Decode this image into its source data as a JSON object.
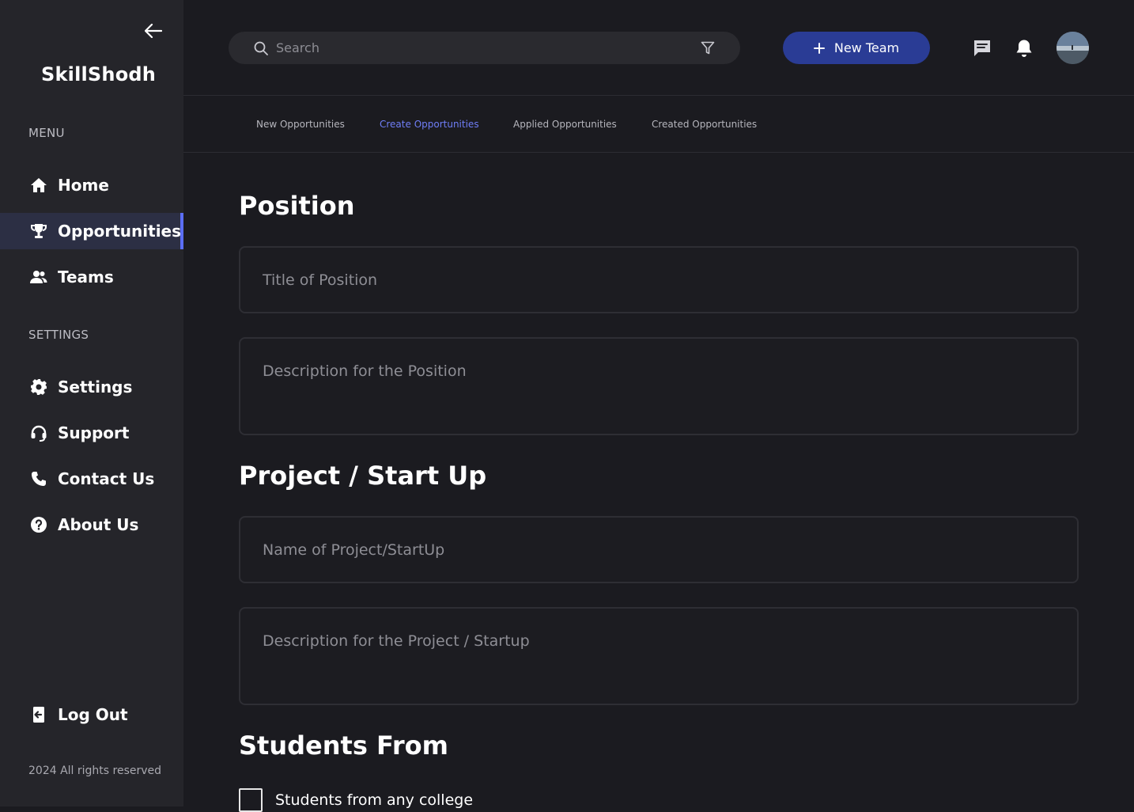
{
  "sidebar": {
    "brand": "SkillShodh",
    "menu_label": "MENU",
    "settings_label": "SETTINGS",
    "menu_items": [
      {
        "label": "Home",
        "icon": "home-icon"
      },
      {
        "label": "Opportunities",
        "icon": "trophy-icon",
        "active": true
      },
      {
        "label": "Teams",
        "icon": "team-icon"
      }
    ],
    "settings_items": [
      {
        "label": "Settings",
        "icon": "gear-icon"
      },
      {
        "label": "Support",
        "icon": "headset-icon"
      },
      {
        "label": "Contact Us",
        "icon": "phone-icon"
      },
      {
        "label": "About Us",
        "icon": "help-circle-icon"
      }
    ],
    "logout": "Log Out",
    "copyright": "2024 All rights reserved"
  },
  "header": {
    "search_placeholder": "Search",
    "new_team": "New Team"
  },
  "tabs": [
    {
      "label": "New Opportunities"
    },
    {
      "label": "Create Opportunities",
      "active": true
    },
    {
      "label": "Applied Opportunities"
    },
    {
      "label": "Created Opportunities"
    }
  ],
  "form": {
    "position_heading": "Position",
    "position_title_placeholder": "Title of Position",
    "position_desc_placeholder": "Description for the Position",
    "project_heading": "Project / Start Up",
    "project_name_placeholder": "Name of Project/StartUp",
    "project_desc_placeholder": "Description for the Project / Startup",
    "students_heading": "Students From",
    "students_any_college": "Students from any college"
  },
  "colors": {
    "accent": "#5b6ef5",
    "tab_active": "#6f7ef7",
    "button": "#2a3c95",
    "sidebar_bg": "#25252a",
    "main_bg": "#1b1b20"
  }
}
